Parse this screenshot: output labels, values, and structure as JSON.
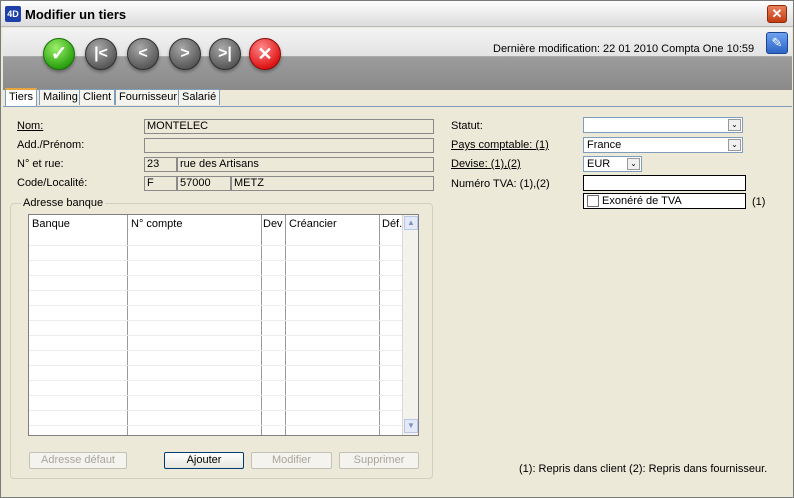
{
  "window": {
    "app_icon": "4D",
    "title": "Modifier un tiers",
    "close_glyph": "✕"
  },
  "toolbar": {
    "ok_glyph": "✓",
    "first_glyph": "|<",
    "prev_glyph": "<",
    "next_glyph": ">",
    "last_glyph": ">|",
    "cancel_glyph": "✕",
    "last_modified": "Dernière modification: 22 01 2010 Compta One 10:59",
    "pen_glyph": "✎"
  },
  "tabs": [
    {
      "label": "Tiers",
      "active": true
    },
    {
      "label": "Mailing",
      "active": false
    },
    {
      "label": "Client",
      "active": false
    },
    {
      "label": "Fournisseur",
      "active": false
    },
    {
      "label": "Salarié",
      "active": false
    }
  ],
  "form": {
    "nom_label": "Nom:",
    "nom_value": "MONTELEC",
    "add_prenom_label": "Add./Prénom:",
    "add_prenom_value": "",
    "rue_label": "N° et rue:",
    "rue_numero": "23",
    "rue_nom": "rue des Artisans",
    "localite_label": "Code/Localité:",
    "pays_code": "F",
    "code_postal": "57000",
    "ville": "METZ"
  },
  "right_form": {
    "statut_label": "Statut:",
    "statut_value": "",
    "pays_label": "Pays comptable: (1)",
    "pays_value": "France",
    "devise_label": "Devise: (1),(2)",
    "devise_value": "EUR",
    "tva_label": "Numéro TVA: (1),(2)",
    "tva_value": "",
    "exonere_label": "Exonéré de TVA",
    "exonere_checked": false,
    "exonere_note": "(1)",
    "dropdown_glyph": "⌄"
  },
  "bank": {
    "group_title": "Adresse banque",
    "columns": [
      "Banque",
      "N° compte",
      "Dev",
      "Créancier",
      "Déf."
    ],
    "rows": [],
    "scroll_up": "▲",
    "scroll_down": "▼",
    "buttons": {
      "default_label": "Adresse défaut",
      "add_label": "Ajouter",
      "modify_label": "Modifier",
      "delete_label": "Supprimer"
    }
  },
  "footnote": "(1): Repris dans client (2): Repris dans fournisseur."
}
